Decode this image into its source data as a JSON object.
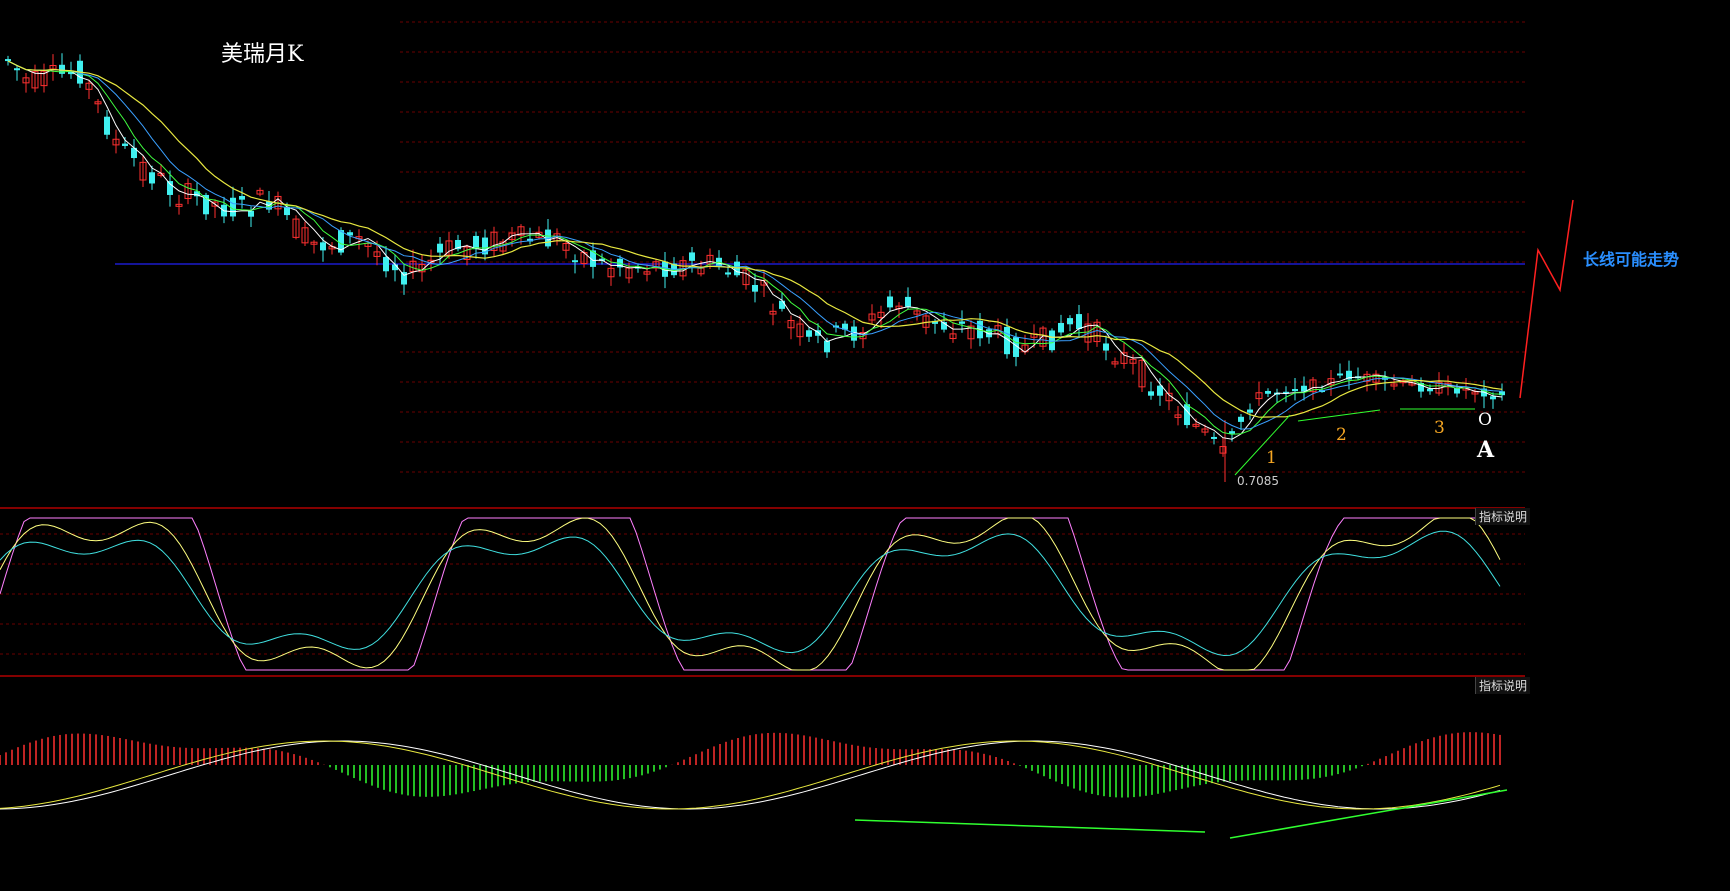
{
  "title": "美瑞月K",
  "forecast_label": "长线可能走势",
  "indicator_button_1": "指标说明",
  "indicator_button_2": "指标说明",
  "wave_labels": [
    "1",
    "2",
    "3"
  ],
  "point_letter": "A",
  "point_marker": "O",
  "low_value_label": "0.7085",
  "colors": {
    "up": "#ff3030",
    "down": "#40f0f0",
    "ma1": "#ffffff",
    "ma2": "#ffff40",
    "ma3": "#40ff40",
    "ma4": "#3aa0ff",
    "ma5": "#e8e840",
    "k_line": "#ff80ff",
    "d_line": "#ffff80",
    "j_line": "#40e0e0",
    "macd_pos": "#ff3030",
    "macd_neg": "#30ff30",
    "support": "#30ff30",
    "resistance": "#1a1acc",
    "forecast": "#ff2020",
    "grid": "#6a0000",
    "separator": "#b00000"
  },
  "chart_data": {
    "type": "candlestick",
    "title": "美瑞月K",
    "low_marker": 0.7085,
    "wave_points": [
      "1",
      "2",
      "3",
      "A"
    ],
    "main_series_shape": [
      {
        "open": 0.96,
        "close": 0.99,
        "high": 1.0
      },
      {
        "open": 0.94,
        "close": 0.9,
        "high": 0.97
      },
      {
        "open": 0.91,
        "close": 0.93,
        "high": 0.95
      },
      {
        "open": 0.92,
        "close": 0.87,
        "high": 0.93
      },
      {
        "open": 0.88,
        "close": 0.82,
        "high": 0.89
      },
      {
        "open": 0.83,
        "close": 0.77,
        "high": 0.84
      }
    ],
    "indicators": [
      "KDJ",
      "MACD"
    ]
  }
}
